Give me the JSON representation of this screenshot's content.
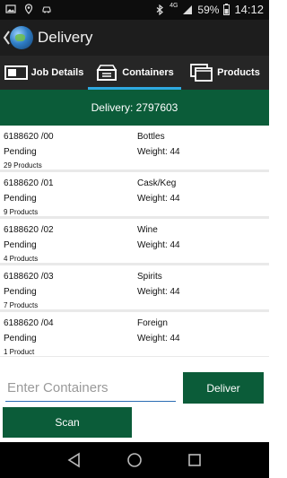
{
  "status_bar": {
    "network_type": "4G",
    "battery": "59%",
    "time": "14:12",
    "icons_left": [
      "image-icon",
      "location-icon",
      "car-icon"
    ],
    "icons_right": [
      "bluetooth-icon",
      "signal-icon",
      "battery-icon"
    ]
  },
  "app_bar": {
    "title": "Delivery",
    "back_icon": "chevron-left-icon",
    "logo_icon": "globe-icon"
  },
  "tabs": [
    {
      "label": "Job Details",
      "icon": "job-details-icon",
      "active": false
    },
    {
      "label": "Containers",
      "icon": "containers-icon",
      "active": true
    },
    {
      "label": "Products",
      "icon": "products-icon",
      "active": false
    }
  ],
  "header": {
    "text": "Delivery: 2797603"
  },
  "containers": [
    {
      "code": "6188620 /00",
      "category": "Bottles",
      "status": "Pending",
      "weight": "Weight: 44",
      "products": "29 Products"
    },
    {
      "code": "6188620 /01",
      "category": "Cask/Keg",
      "status": "Pending",
      "weight": "Weight: 44",
      "products": "9 Products"
    },
    {
      "code": "6188620 /02",
      "category": "Wine",
      "status": "Pending",
      "weight": "Weight: 44",
      "products": "4 Products"
    },
    {
      "code": "6188620 /03",
      "category": "Spirits",
      "status": "Pending",
      "weight": "Weight: 44",
      "products": "7 Products"
    },
    {
      "code": "6188620 /04",
      "category": "Foreign",
      "status": "Pending",
      "weight": "Weight: 44",
      "products": "1 Product"
    }
  ],
  "input": {
    "placeholder": "Enter Containers",
    "value": ""
  },
  "buttons": {
    "deliver": "Deliver",
    "scan": "Scan"
  },
  "nav_bar": {
    "icons": [
      "back-triangle-icon",
      "home-circle-icon",
      "recents-square-icon"
    ]
  },
  "colors": {
    "accent_green": "#0b5c39",
    "tab_indicator": "#2fa8e0",
    "input_underline": "#2a6db3"
  }
}
